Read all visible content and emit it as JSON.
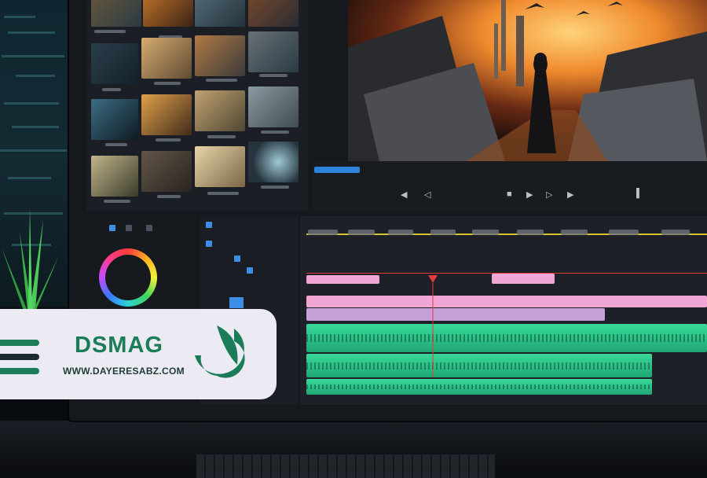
{
  "branding": {
    "title": "DSMAG",
    "url": "WWW.DAYERESABZ.COM",
    "accent_color": "#1a7d58",
    "logo_icon": "leaf-logo-icon",
    "menu_icon": "hamburger-menu-icon"
  },
  "player": {
    "controls": [
      "skip-back-icon",
      "step-back-icon",
      "stop-icon",
      "play-icon",
      "step-forward-icon",
      "skip-forward-icon",
      "loop-icon"
    ]
  },
  "colors": {
    "playhead": "#e23b3b",
    "video_clip": "#f2a6d6",
    "audio_clip": "#39d99a",
    "selection": "#2f82d9",
    "timeline_marker": "#d7c32c"
  }
}
